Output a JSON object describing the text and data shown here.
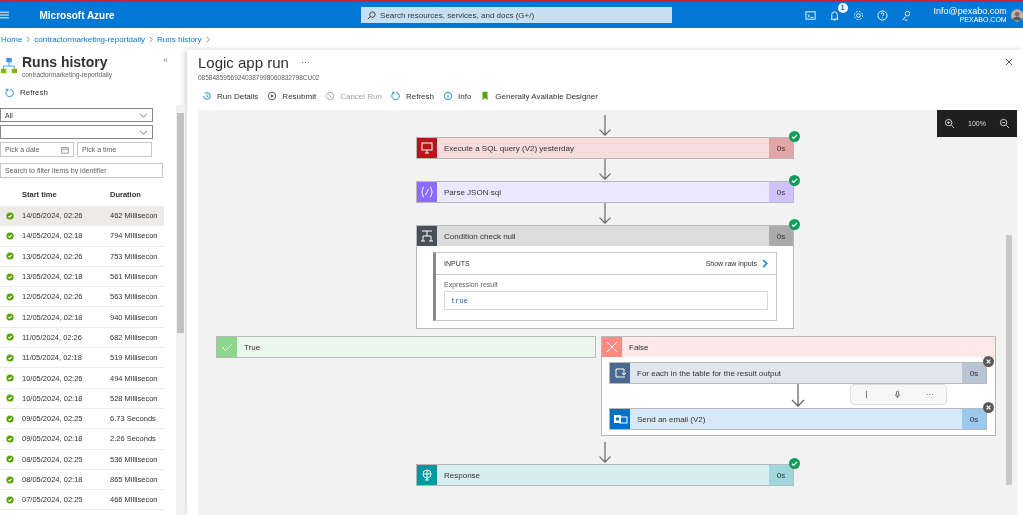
{
  "topbar": {
    "brand": "Microsoft Azure",
    "search": {
      "placeholder": "Search resources, services, and docs (G+/)"
    },
    "notification_count": "1",
    "account": {
      "email": "Info@pexabo.com",
      "org": "PEXABO.COM"
    }
  },
  "breadcrumb": [
    "Home",
    "contractormarketing-reportdaily",
    "Runs history"
  ],
  "runs_panel": {
    "title": "Runs history",
    "subtitle": "contractormarketing-reportdaily",
    "collapse": "«",
    "refresh": "Refresh",
    "status_filter": "All",
    "date_placeholder": "Pick a date",
    "time_placeholder": "Pick a time",
    "search_placeholder": "Search to filter items by identifier",
    "columns": [
      "Start time",
      "Duration"
    ],
    "rows": [
      {
        "start": "14/05/2024, 02:26",
        "duration": "462 Millisecon",
        "succeeded": true,
        "selected": true
      },
      {
        "start": "14/05/2024, 02:18",
        "duration": "794 Millisecon",
        "succeeded": true,
        "selected": false
      },
      {
        "start": "13/05/2024, 02:26",
        "duration": "753 Millisecon",
        "succeeded": true,
        "selected": false
      },
      {
        "start": "13/05/2024, 02:18",
        "duration": "561 Millisecon",
        "succeeded": true,
        "selected": false
      },
      {
        "start": "12/05/2024, 02:26",
        "duration": "563 Millisecon",
        "succeeded": true,
        "selected": false
      },
      {
        "start": "12/05/2024, 02:18",
        "duration": "940 Millisecon",
        "succeeded": true,
        "selected": false
      },
      {
        "start": "11/05/2024, 02:26",
        "duration": "682 Millisecon",
        "succeeded": true,
        "selected": false
      },
      {
        "start": "11/05/2024, 02:18",
        "duration": "519 Millisecon",
        "succeeded": true,
        "selected": false
      },
      {
        "start": "10/05/2024, 02:26",
        "duration": "494 Millisecon",
        "succeeded": true,
        "selected": false
      },
      {
        "start": "10/05/2024, 02:18",
        "duration": "528 Millisecon",
        "succeeded": true,
        "selected": false
      },
      {
        "start": "09/05/2024, 02:25",
        "duration": "6.73 Seconds",
        "succeeded": true,
        "selected": false
      },
      {
        "start": "09/05/2024, 02:18",
        "duration": "2.26 Seconds",
        "succeeded": true,
        "selected": false
      },
      {
        "start": "08/05/2024, 02:25",
        "duration": "536 Millisecon",
        "succeeded": true,
        "selected": false
      },
      {
        "start": "08/05/2024, 02:18",
        "duration": "865 Millisecon",
        "succeeded": true,
        "selected": false
      },
      {
        "start": "07/05/2024, 02:25",
        "duration": "466 Millisecon",
        "succeeded": true,
        "selected": false
      }
    ]
  },
  "run": {
    "title": "Logic app run",
    "more": "···",
    "run_id": "08584859569240387998060832798CU02",
    "toolbar": [
      {
        "kind": "details",
        "label": "Run Details",
        "disabled": false
      },
      {
        "kind": "resubmit",
        "label": "Resubmit",
        "disabled": false
      },
      {
        "kind": "cancel",
        "label": "Cancel Run",
        "disabled": true
      },
      {
        "kind": "refresh",
        "label": "Refresh",
        "disabled": false
      },
      {
        "kind": "info",
        "label": "Info",
        "disabled": false
      },
      {
        "kind": "designer",
        "label": "Generally Available Designer",
        "disabled": false
      }
    ]
  },
  "designer": {
    "zoom": "100%",
    "steps": [
      {
        "kind": "sql",
        "title": "Execute a SQL query (V2) yesterday",
        "duration": "0s",
        "succeeded": true
      },
      {
        "kind": "json",
        "title": "Parse JSON sql",
        "duration": "0s",
        "succeeded": true
      },
      {
        "kind": "condition",
        "title": "Condition check null",
        "duration": "0s",
        "succeeded": true,
        "inputs": {
          "label": "INPUTS",
          "show_raw": "Show raw inputs",
          "field": "Expression result",
          "value": "true"
        },
        "branches": [
          {
            "kind": "true",
            "label": "True"
          },
          {
            "kind": "false",
            "label": "False",
            "steps": [
              {
                "kind": "foreach",
                "title": "For each in the table for the result output",
                "duration": "0s",
                "succeeded": false
              },
              {
                "kind": "email",
                "title": "Send an email (V2)",
                "duration": "0s",
                "succeeded": false
              }
            ]
          }
        ]
      },
      {
        "kind": "response",
        "title": "Response",
        "duration": "0s",
        "succeeded": true
      }
    ],
    "hover_toolbar": {
      "more": "···"
    }
  }
}
